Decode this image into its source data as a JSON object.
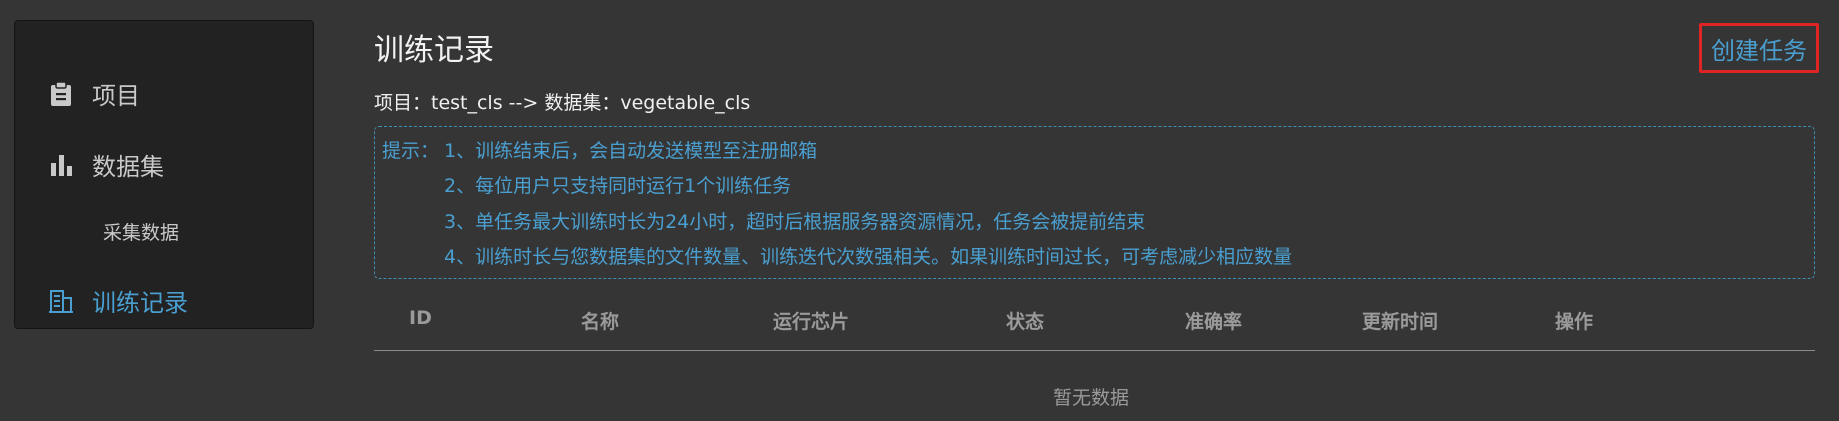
{
  "sidebar": {
    "items": [
      {
        "label": "项目",
        "icon": "clipboard-icon"
      },
      {
        "label": "数据集",
        "icon": "bar-chart-icon"
      },
      {
        "label": "采集数据"
      },
      {
        "label": "训练记录",
        "icon": "building-icon",
        "active": true
      }
    ]
  },
  "page": {
    "title": "训练记录",
    "create_label": "创建任务",
    "breadcrumb": "项目：test_cls --> 数据集：vegetable_cls"
  },
  "tips": {
    "prefix": "提示：",
    "lines": [
      "1、训练结束后，会自动发送模型至注册邮箱",
      "2、每位用户只支持同时运行1个训练任务",
      "3、单任务最大训练时长为24小时，超时后根据服务器资源情况，任务会被提前结束",
      "4、训练时长与您数据集的文件数量、训练迭代次数强相关。如果训练时间过长，可考虑减少相应数量"
    ]
  },
  "table": {
    "columns": [
      "ID",
      "名称",
      "运行芯片",
      "状态",
      "准确率",
      "更新时间",
      "操作"
    ],
    "empty_text": "暂无数据"
  },
  "colors": {
    "accent": "#4a9fd0",
    "highlight_border": "#e02323",
    "background": "#353535",
    "sidebar_bg": "#222222"
  }
}
